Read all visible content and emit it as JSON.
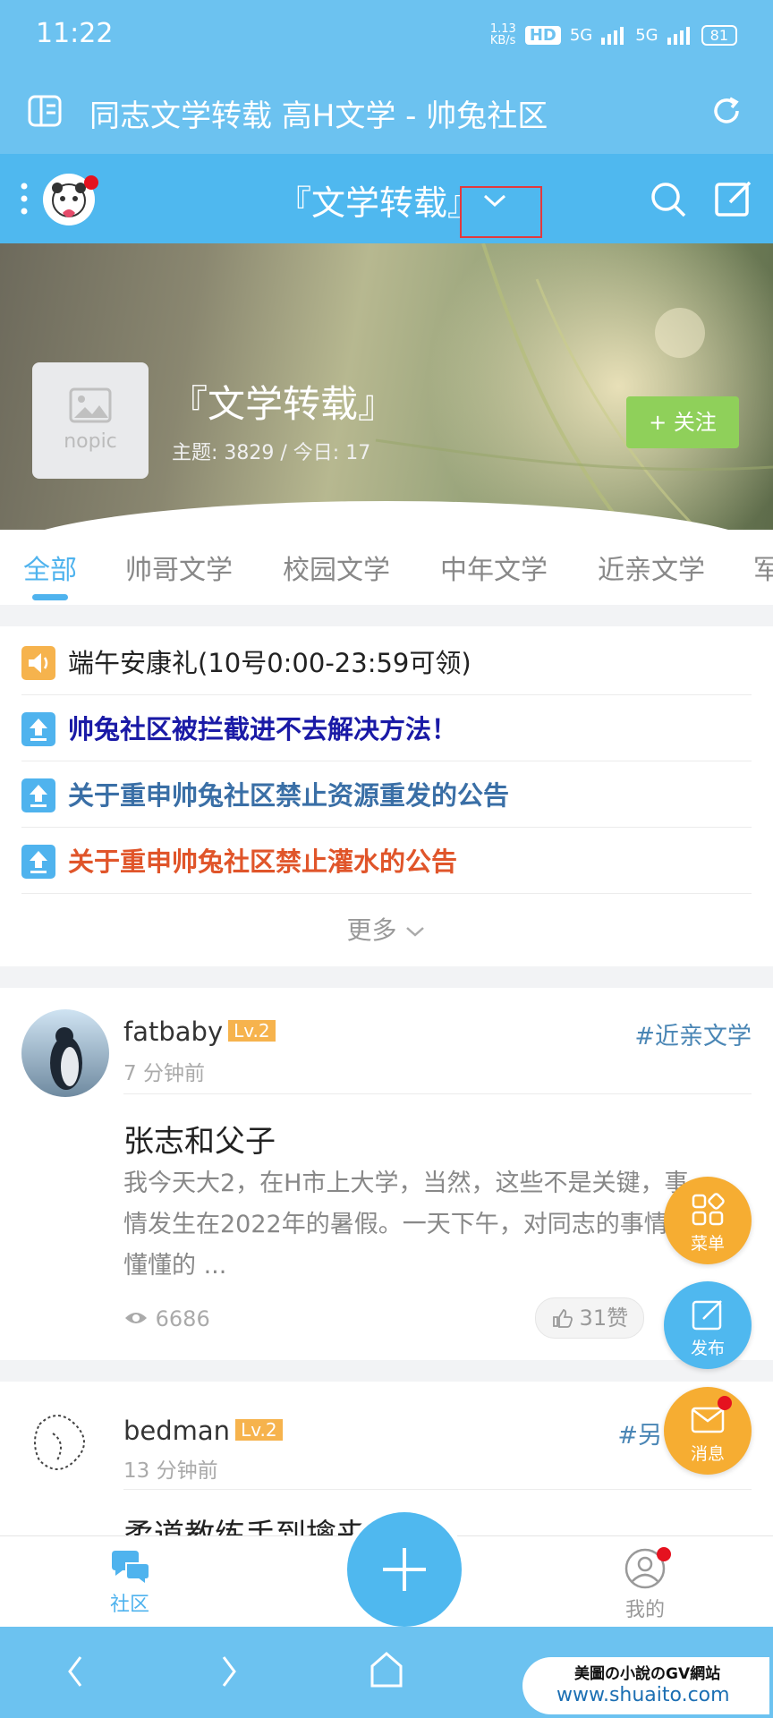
{
  "status": {
    "time": "11:22",
    "speed": "1.13\nKB/s",
    "hd": "HD",
    "net1": "5G",
    "net2": "5G",
    "battery": "81"
  },
  "title_bar": {
    "title": "同志文学转载 高H文学 - 帅兔社区"
  },
  "forum_header": {
    "name": "『文学转载』"
  },
  "banner": {
    "nopic": "nopic",
    "title": "『文学转载』",
    "stats": "主题: 3829  /  今日: 17",
    "follow": "+ 关注"
  },
  "tabs": [
    "全部",
    "帅哥文学",
    "校园文学",
    "中年文学",
    "近亲文学",
    "军"
  ],
  "notices": [
    {
      "text": "端午安康礼(10号0:00-23:59可领)",
      "color": "#222222",
      "icon_color": "#f6b34d",
      "icon": "speaker-icon"
    },
    {
      "text": "帅兔社区被拦截进不去解决方法！",
      "color": "#1a1aa6",
      "icon_color": "#4fb3ee",
      "icon": "upload-arrow-icon"
    },
    {
      "text": "关于重申帅兔社区禁止资源重发的公告",
      "color": "#3a6fa6",
      "icon_color": "#4fb3ee",
      "icon": "upload-arrow-icon"
    },
    {
      "text": "关于重申帅兔社区禁止灌水的公告",
      "color": "#e0552a",
      "icon_color": "#4fb3ee",
      "icon": "upload-arrow-icon"
    }
  ],
  "more": "更多",
  "posts": [
    {
      "user": "fatbaby",
      "level": "Lv.2",
      "time": "7 分钟前",
      "tag": "#近亲文学",
      "title": "张志和父子",
      "excerpt": "我今天大2，在H市上大学，当然，这些不是关键，事情发生在2022年的暑假。一天下午，对同志的事情懵懂懂的 ...",
      "views": "6686",
      "likes": "31赞"
    },
    {
      "user": "bedman",
      "level": "Lv.2",
      "time": "13 分钟前",
      "tag": "#另",
      "title": "柔道教练手到擒来"
    }
  ],
  "fabs": {
    "menu": "菜单",
    "publish": "发布",
    "message": "消息"
  },
  "bottom_nav": {
    "community": "社区",
    "mine": "我的"
  },
  "watermark": {
    "line1": "美圖の小說のGV網站",
    "line2": "www.shuaito.com"
  },
  "colors": {
    "primary": "#4fb8ef",
    "accent_orange": "#f6b34d",
    "follow_green": "#8fd05a"
  }
}
